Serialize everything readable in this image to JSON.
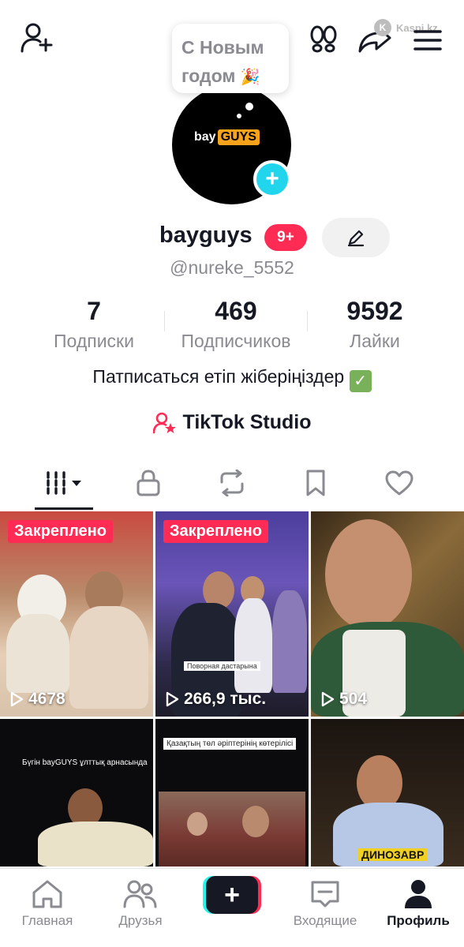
{
  "watermark": "Kaspi.kz",
  "bubble": {
    "line1": "С Новым",
    "line2": "годом",
    "emoji": "🎉"
  },
  "avatar": {
    "logo_left": "bay",
    "logo_right": "GUYS"
  },
  "profile": {
    "name": "bayguys",
    "badge": "9+",
    "handle": "@nureke_5552",
    "bio": "Патписаться етіп жіберіңіздер",
    "bio_emoji": "✓"
  },
  "stats": [
    {
      "value": "7",
      "label": "Подписки"
    },
    {
      "value": "469",
      "label": "Подписчиков"
    },
    {
      "value": "9592",
      "label": "Лайки"
    }
  ],
  "studio_label": "TikTok Studio",
  "videos": [
    {
      "pinned": "Закреплено",
      "views": "4678"
    },
    {
      "pinned": "Закреплено",
      "views": "266,9 тыс.",
      "caption": "Поворная дастарына"
    },
    {
      "views": "504"
    },
    {
      "caption": "Бүгін bayGUYS ұлттық арнасында"
    },
    {
      "caption": "Қазақтың төл әріптерінің көтерілісі"
    },
    {
      "caption": "ДИНОЗАВР"
    }
  ],
  "nav": [
    {
      "label": "Главная"
    },
    {
      "label": "Друзья"
    },
    {
      "label": "Входящие"
    },
    {
      "label": "Профиль"
    }
  ],
  "colors": {
    "accent": "#fe2c55",
    "cyan": "#25f4ee",
    "text": "#161823",
    "muted": "#8a8b91"
  }
}
